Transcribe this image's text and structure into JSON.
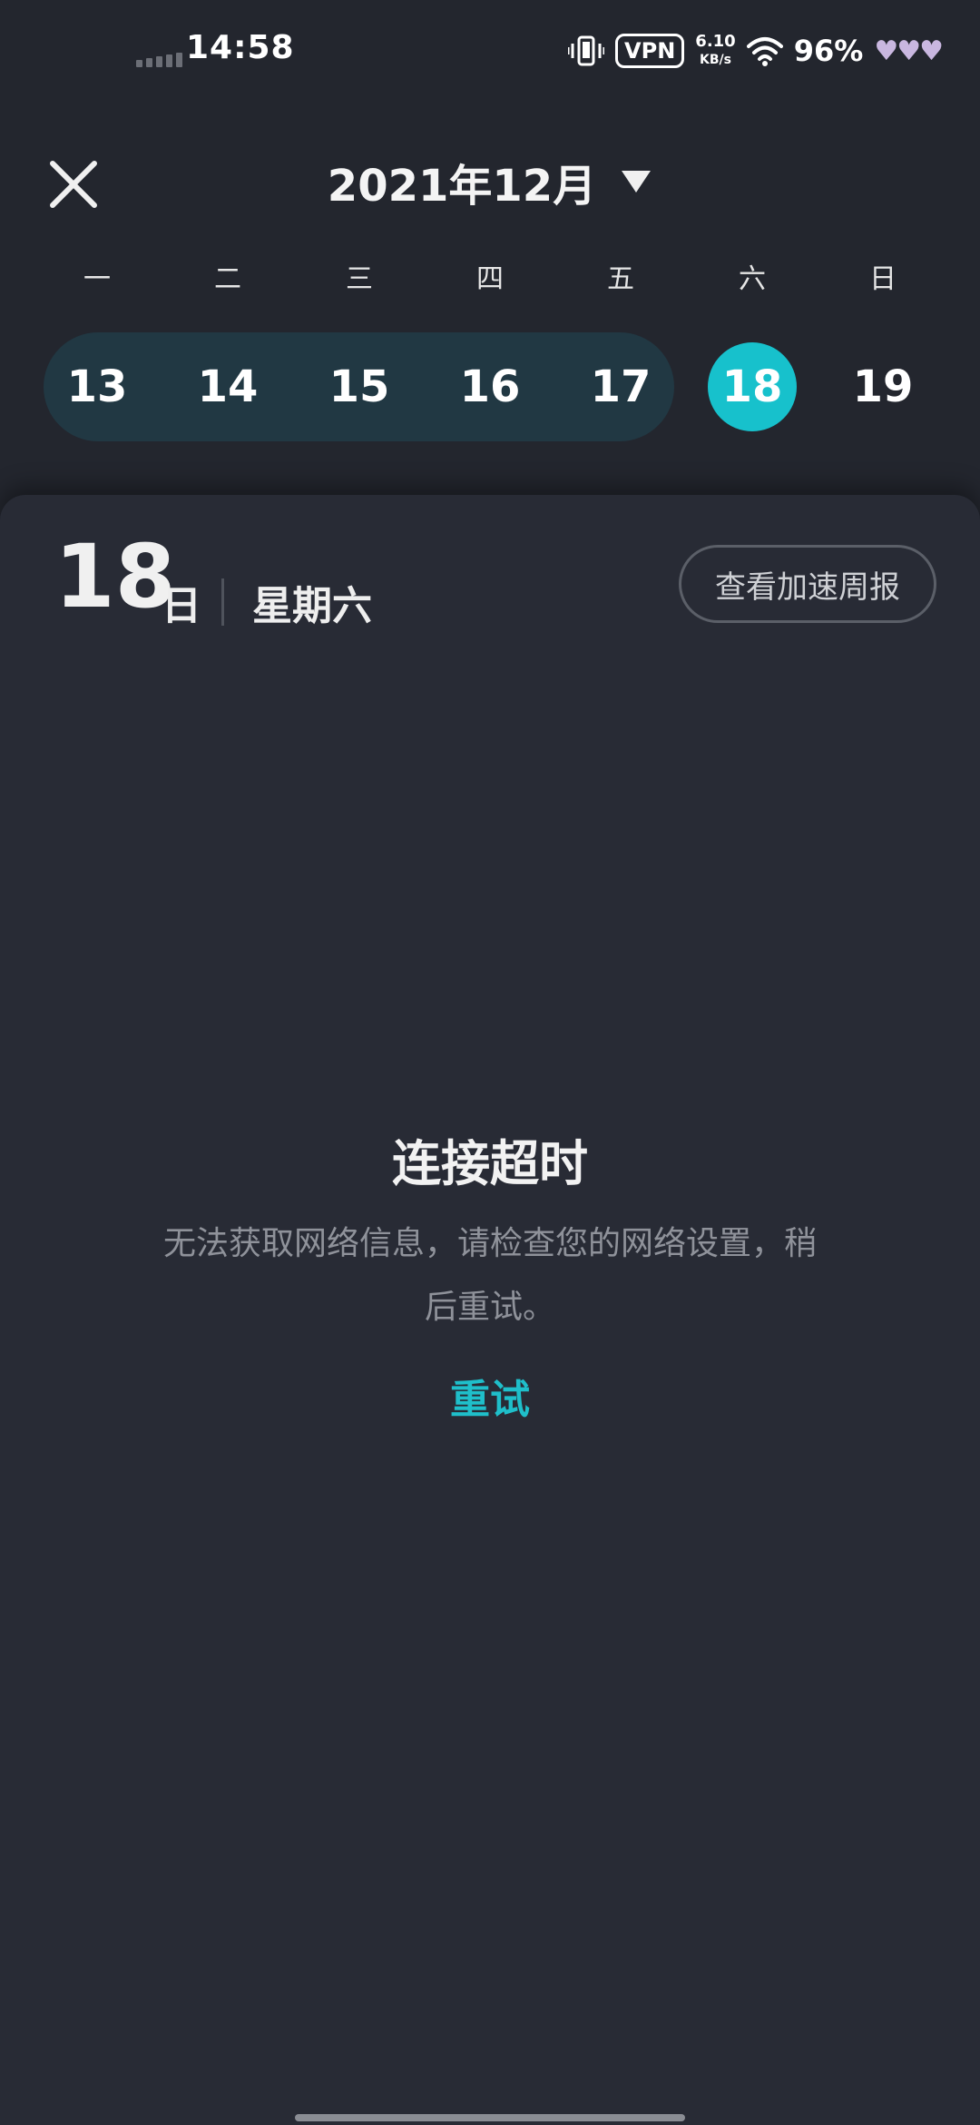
{
  "status_bar": {
    "time": "14:58",
    "vpn": "VPN",
    "net_speed_value": "6.10",
    "net_speed_unit": "KB/s",
    "battery": "96%",
    "hearts": "♥♥♥",
    "icons": [
      "signal-icon",
      "vibrate-icon",
      "wifi-icon"
    ]
  },
  "header": {
    "close_icon": "close-icon",
    "month_label": "2021年12月",
    "dropdown_icon": "caret-down-icon"
  },
  "weekdays": [
    "一",
    "二",
    "三",
    "四",
    "五",
    "六",
    "日"
  ],
  "week": {
    "days": [
      "13",
      "14",
      "15",
      "16",
      "17",
      "18",
      "19"
    ],
    "selected": "18",
    "highlight_color": "#213843",
    "selected_color": "#17c1cc"
  },
  "detail": {
    "day_number": "18",
    "day_unit": "日",
    "weekday": "星期六",
    "report_button": "查看加速周报"
  },
  "error": {
    "title": "连接超时",
    "message": "无法获取网络信息，请检查您的网络设置，稍后重试。",
    "retry": "重试",
    "accent_color": "#1fbfca"
  }
}
